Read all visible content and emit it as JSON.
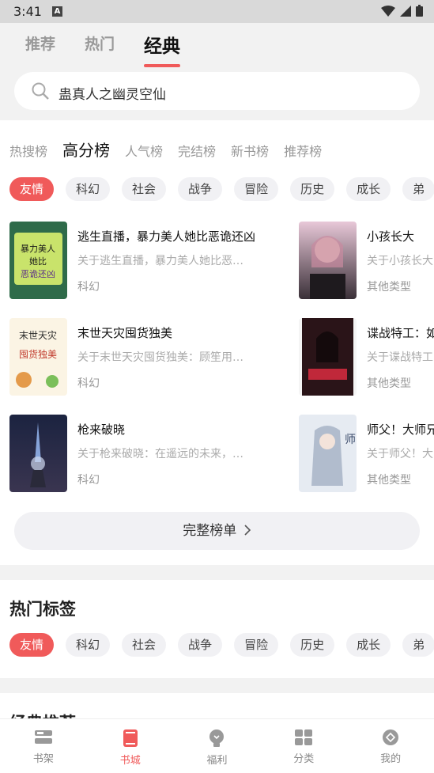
{
  "status": {
    "time": "3:41",
    "notif_icon": "a-icon"
  },
  "top_tabs": [
    "推荐",
    "热门",
    "经典"
  ],
  "search": {
    "placeholder": "蛊真人之幽灵空仙"
  },
  "rank_tabs": [
    "热搜榜",
    "高分榜",
    "人气榜",
    "完结榜",
    "新书榜",
    "推荐榜"
  ],
  "categories": [
    "友情",
    "科幻",
    "社会",
    "战争",
    "冒险",
    "历史",
    "成长",
    "弟"
  ],
  "books_left": [
    {
      "title": "逃生直播，暴力美人她比恶诡还凶",
      "desc": "关于逃生直播，暴力美人她比恶…",
      "genre": "科幻",
      "cover_text": "暴力美人她比恶诡还凶"
    },
    {
      "title": "末世天灾囤货独美",
      "desc": "关于末世天灾囤货独美：顾笙用…",
      "genre": "科幻",
      "cover_text": "末世天灾囤货独美"
    },
    {
      "title": "枪来破晓",
      "desc": "关于枪来破晓：在遥远的未来，…",
      "genre": "科幻",
      "cover_text": ""
    }
  ],
  "books_right": [
    {
      "title": "小孩长大",
      "desc": "关于小孩长大",
      "genre": "其他类型"
    },
    {
      "title": "谍战特工：如",
      "desc": "关于谍战特工",
      "genre": "其他类型"
    },
    {
      "title": "师父！大师兄",
      "desc": "关于师父！大",
      "genre": "其他类型"
    }
  ],
  "full_list_button": "完整榜单",
  "hot_tags": {
    "title": "热门标签",
    "tags": [
      "友情",
      "科幻",
      "社会",
      "战争",
      "冒险",
      "历史",
      "成长",
      "弟"
    ]
  },
  "classic_title": "经典推荐",
  "bottom_nav": [
    "书架",
    "书城",
    "福利",
    "分类",
    "我的"
  ],
  "colors": {
    "accent": "#f05a5a"
  }
}
